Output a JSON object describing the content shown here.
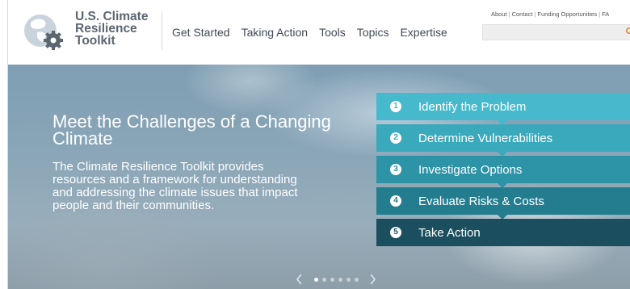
{
  "colors": {
    "step1": "#46b9cc",
    "step2": "#3aa9bc",
    "step3": "#2d93a6",
    "step4": "#247d8f",
    "step5": "#1b4e5e",
    "search_icon": "#e68a2e"
  },
  "logo": {
    "line1": "U.S. Climate",
    "line2": "Resilience",
    "line3": "Toolkit",
    "icon": "globe-gear-logo"
  },
  "nav": {
    "items": [
      "Get Started",
      "Taking Action",
      "Tools",
      "Topics",
      "Expertise"
    ]
  },
  "utility": {
    "links": [
      "About",
      "Contact",
      "Funding Opportunities",
      "FA"
    ]
  },
  "search": {
    "placeholder": "",
    "icon": "search-icon"
  },
  "hero": {
    "title": "Meet the Challenges of a Changing Climate",
    "description": "The Climate Resilience Toolkit provides resources and a framework for understanding and addressing the climate issues that impact people and their communities."
  },
  "steps": [
    {
      "num": "1",
      "label": "Identify the Problem"
    },
    {
      "num": "2",
      "label": "Determine Vulnerabilities"
    },
    {
      "num": "3",
      "label": "Investigate Options"
    },
    {
      "num": "4",
      "label": "Evaluate Risks & Costs"
    },
    {
      "num": "5",
      "label": "Take Action"
    }
  ],
  "carousel": {
    "slide_count": 6,
    "active_slide": 1
  }
}
